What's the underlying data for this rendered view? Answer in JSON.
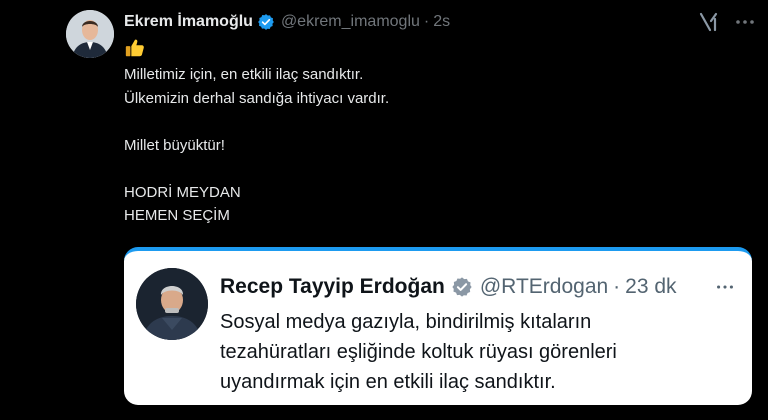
{
  "tweet": {
    "author_name": "Ekrem İmamoğlu",
    "handle": "@ekrem_imamoglu",
    "separator": "·",
    "time": "2s",
    "emoji_icon": "thumbs-up-icon",
    "lines": [
      "Milletimiz için, en etkili ilaç sandıktır.",
      "Ülkemizin derhal sandığa ihtiyacı vardır.",
      "",
      "Millet büyüktür!",
      "",
      "HODRİ MEYDAN",
      "HEMEN SEÇİM"
    ]
  },
  "quoted_tweet": {
    "author_name": "Recep Tayyip Erdoğan",
    "handle": "@RTErdogan",
    "separator": "·",
    "time": "23 dk",
    "lines": [
      "Sosyal medya gazıyla, bindirilmiş kıtaların",
      "tezahüratları eşliğinde koltuk rüyası görenleri",
      "uyandırmak için en etkili ilaç sandıktır."
    ]
  },
  "colors": {
    "background": "#000000",
    "verified_badge": "#1d9bf0",
    "quote_accent": "#1d9bf0",
    "quote_background": "#ffffff"
  }
}
